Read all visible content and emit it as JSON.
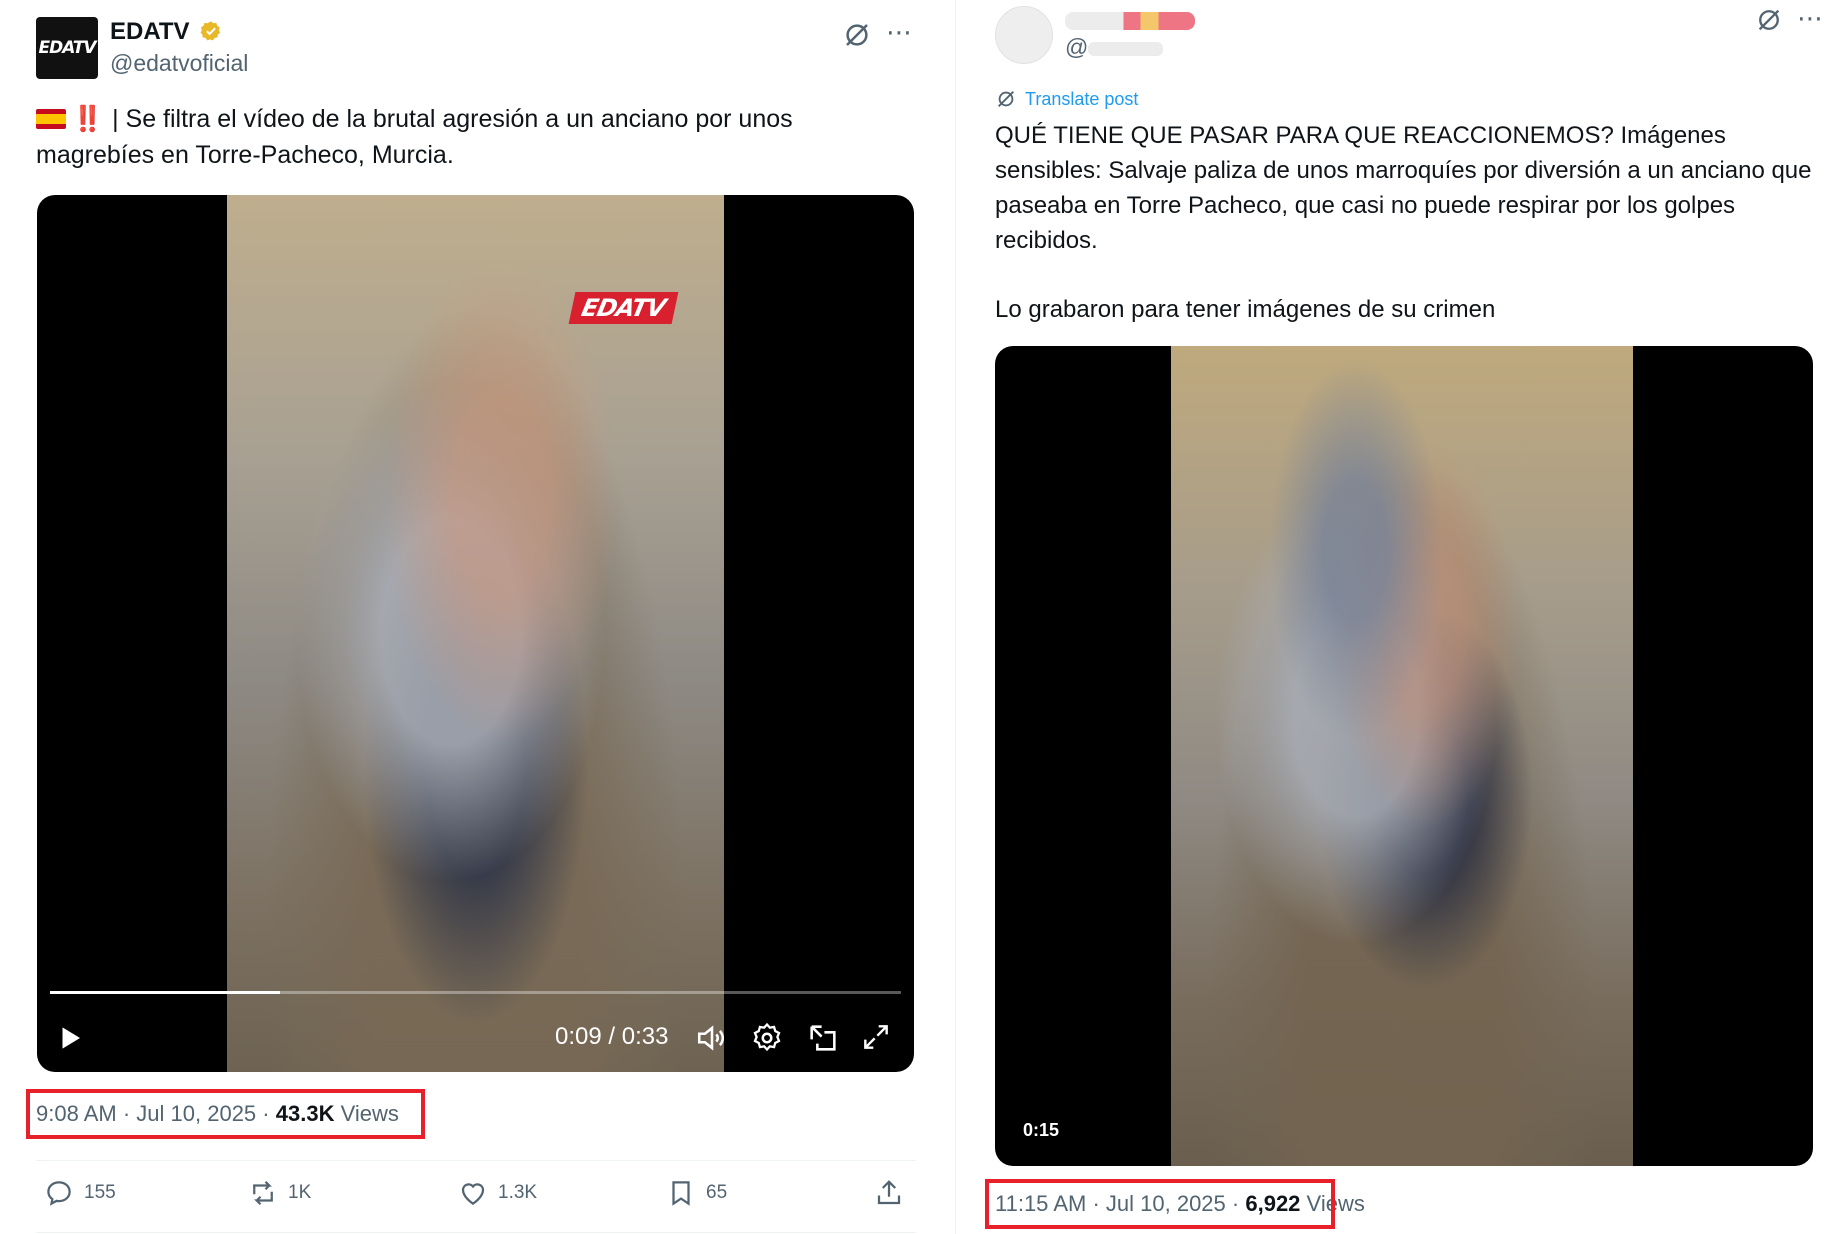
{
  "left_post": {
    "display_name": "EDATV",
    "handle": "@edatvoficial",
    "avatar_text": "EDATV",
    "text_prefix": "‼️",
    "text": "| Se filtra el vídeo de la brutal agresión a un anciano por unos magrebíes en Torre-Pacheco, Murcia.",
    "video": {
      "watermark": "EDATV",
      "time_readout": "0:09 / 0:33",
      "progress_fraction": 0.27
    },
    "meta": {
      "time": "9:08 AM",
      "separator": "·",
      "date": "Jul 10, 2025",
      "views_count": "43.3K",
      "views_label": "Views"
    },
    "actions": {
      "replies": "155",
      "reposts": "1K",
      "likes": "1.3K",
      "bookmarks": "65"
    }
  },
  "right_post": {
    "display_name": "",
    "handle": "@",
    "translate_label": "Translate post",
    "text_p1": "QUÉ TIENE QUE PASAR PARA QUE REACCIONEMOS? Imágenes sensibles: Salvaje paliza de unos marroquíes por diversión a un anciano que paseaba en Torre Pacheco, que casi no puede respirar por los golpes recibidos.",
    "text_p2": "Lo grabaron para tener imágenes de su crimen",
    "video": {
      "duration_badge": "0:15"
    },
    "meta": {
      "time": "11:15 AM",
      "separator": "·",
      "date": "Jul 10, 2025",
      "views_count": "6,922",
      "views_label": "Views"
    }
  },
  "colors": {
    "highlight_box": "#e8202a",
    "link_blue": "#1d9bf0",
    "verified_gold": "#e8b829",
    "secondary_text": "#536471"
  },
  "icons": [
    "verified-badge-icon",
    "grok-icon",
    "more-icon",
    "play-icon",
    "volume-icon",
    "settings-icon",
    "pip-icon",
    "fullscreen-icon",
    "reply-icon",
    "repost-icon",
    "like-icon",
    "bookmark-icon",
    "share-icon",
    "translate-icon"
  ]
}
